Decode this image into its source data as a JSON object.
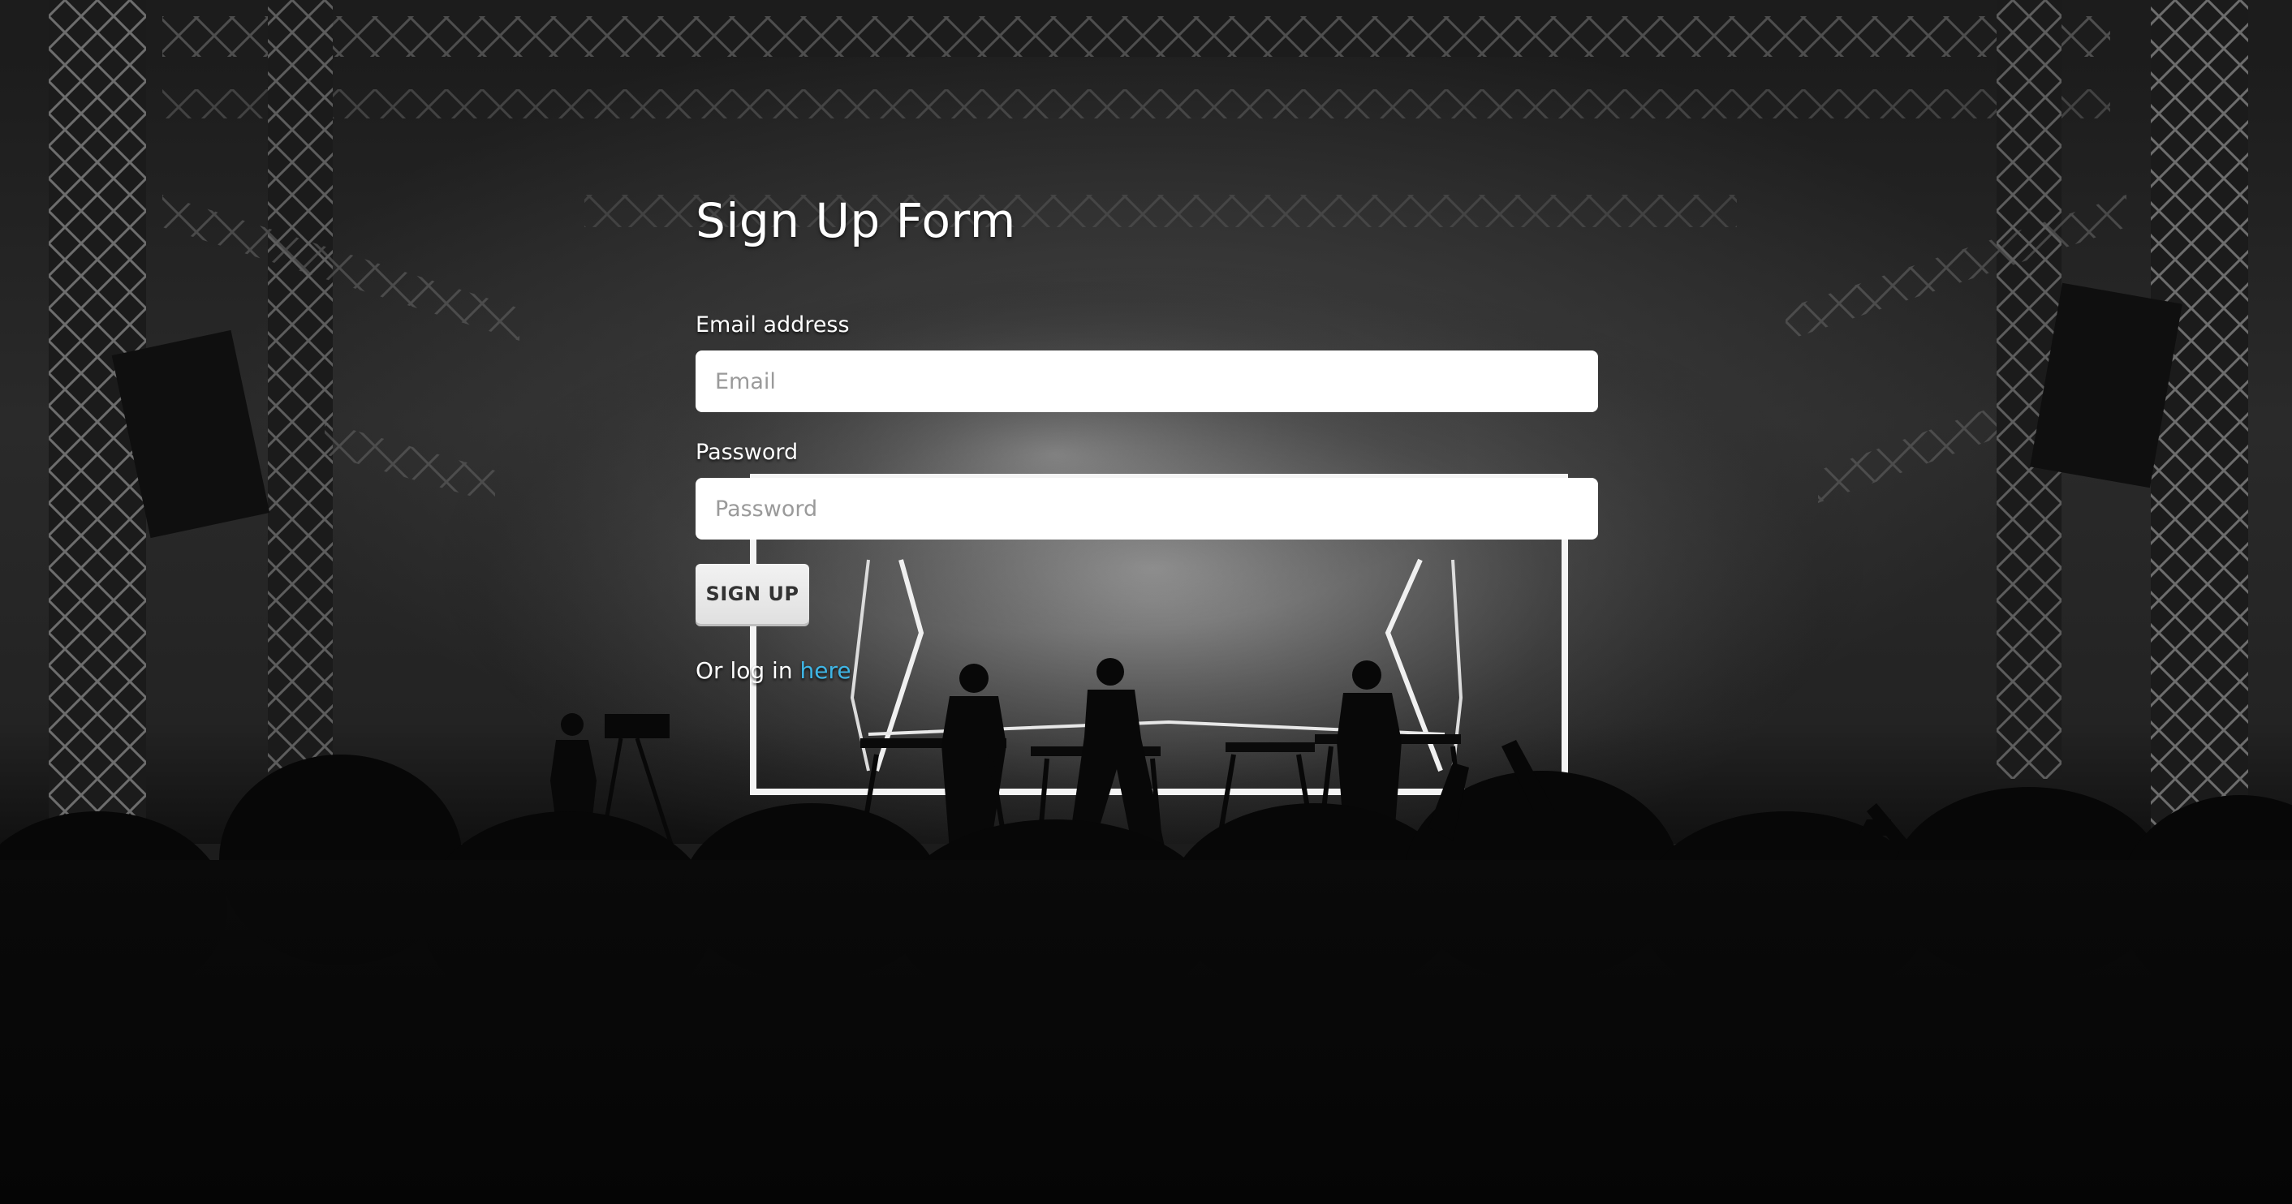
{
  "form": {
    "title": "Sign Up Form",
    "email_label": "Email address",
    "email_placeholder": "Email",
    "email_value": "",
    "password_label": "Password",
    "password_placeholder": "Password",
    "password_value": "",
    "submit_label": "SIGN UP",
    "login_prefix": "Or log in",
    "login_link": "here"
  },
  "background": {
    "description_icon": "concert-stage-photo"
  },
  "colors": {
    "link": "#3fb6e6",
    "text": "#ffffff",
    "button_bg": "#ececec"
  }
}
